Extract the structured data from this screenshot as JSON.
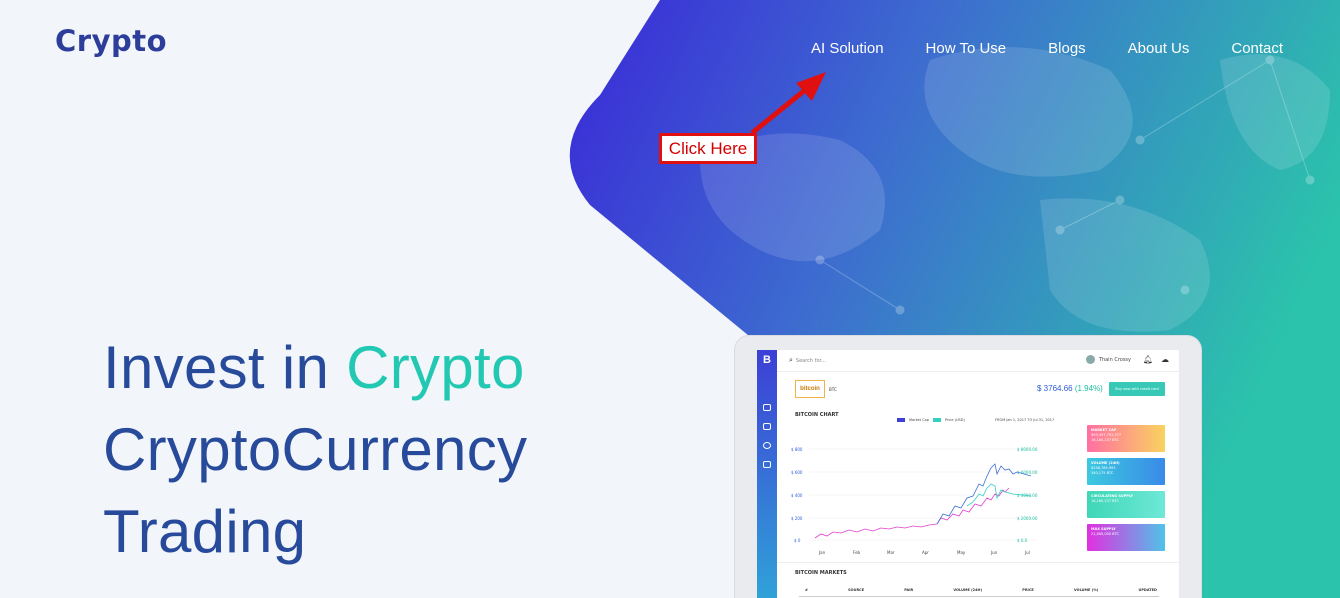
{
  "brand": {
    "logo": "Crypto"
  },
  "nav": {
    "items": [
      "AI Solution",
      "How To Use",
      "Blogs",
      "About Us",
      "Contact"
    ]
  },
  "callout": {
    "label": "Click Here"
  },
  "hero": {
    "line1_prefix": "Invest in ",
    "line1_accent": "Crypto",
    "line2": "CryptoCurrency",
    "line3": "Trading"
  },
  "dashboard": {
    "search_placeholder": "Search for...",
    "user_name": "Thain Crossy",
    "coin_logo": "bitcoin",
    "coin_code": "BTC",
    "price": "$ 3764.66",
    "change": "(1.94%)",
    "buy_button": "Buy now with credit card",
    "chart_title": "BITCOIN CHART",
    "legend_market_cap": "Market Cap",
    "legend_price": "Price (USD)",
    "range_label": "FROM   Jan 1, 2017   TO   Jul 31, 2017",
    "y_left": [
      "$ 800",
      "$ 600",
      "$ 400",
      "$ 200",
      "$ 0"
    ],
    "y_right": [
      "$ 8000.00",
      "$ 6000.00",
      "$ 4000.00",
      "$ 2000.00",
      "$ 0.0"
    ],
    "months": [
      "Jan",
      "Feb",
      "Mar",
      "Apr",
      "May",
      "Jun",
      "Jul"
    ],
    "stats": [
      {
        "title": "MARKET CAP",
        "line1": "$93,497,791,377",
        "line2": "16,180,237 BTC"
      },
      {
        "title": "VOLUME (24H)",
        "line1": "$258,765,993",
        "line2": "340,175 BTC"
      },
      {
        "title": "CIRCULATING SUPPLY",
        "line1": "16,180,237 BTC",
        "line2": ""
      },
      {
        "title": "MAX SUPPLY",
        "line1": "21,000,000 BTC",
        "line2": ""
      }
    ],
    "markets_title": "BITCOIN MARKETS",
    "market_columns": [
      "#",
      "SOURCE",
      "PAIR",
      "VOLUME (24H)",
      "PRICE",
      "VOLUME (%)",
      "UPDATED"
    ]
  },
  "colors": {
    "gradient_start": "#3b2fd6",
    "gradient_end": "#2ec2ad",
    "headline": "#274a9b",
    "accent": "#22c8b2",
    "callout_border": "#e01010"
  }
}
